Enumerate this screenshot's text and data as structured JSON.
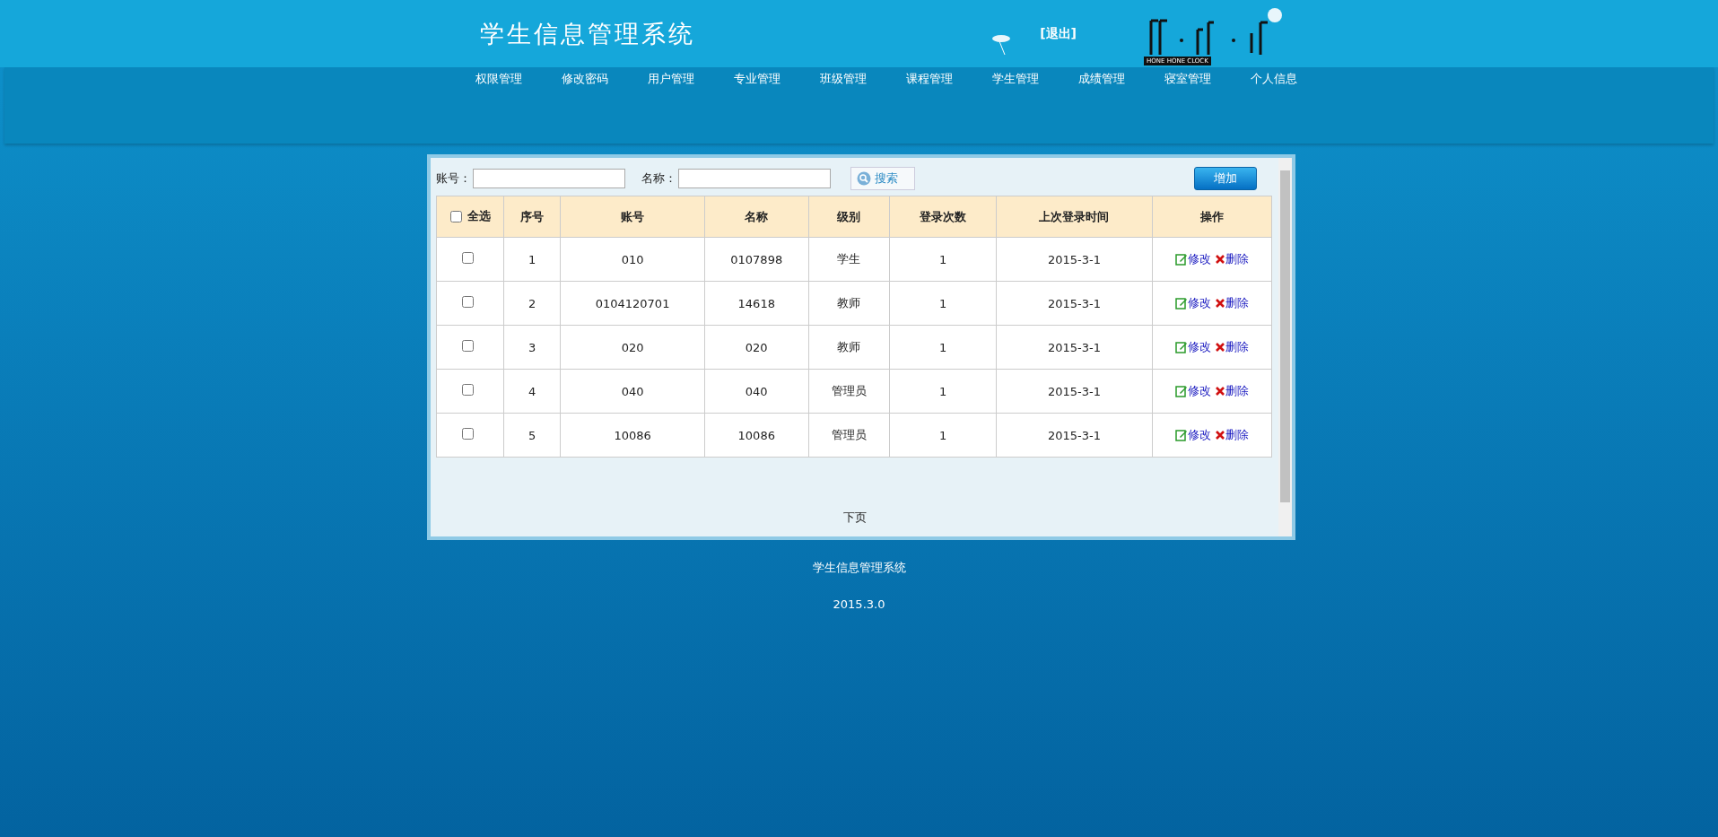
{
  "header": {
    "title": "学生信息管理系统",
    "logout": "[退出]",
    "clock_label": "HONE HONE CLOCK"
  },
  "nav": [
    "权限管理",
    "修改密码",
    "用户管理",
    "专业管理",
    "班级管理",
    "课程管理",
    "学生管理",
    "成绩管理",
    "寝室管理",
    "个人信息"
  ],
  "search": {
    "fields": [
      {
        "label": "账号："
      },
      {
        "label": "名称："
      }
    ],
    "search_button": "搜索",
    "add_button": "增加"
  },
  "table": {
    "select_all": {
      "label": "全选",
      "checked": false
    },
    "columns": [
      "序号",
      "账号",
      "名称",
      "级别",
      "登录次数",
      "上次登录时间",
      "操作"
    ],
    "rows": [
      {
        "checked": false,
        "cells": [
          "1",
          "010",
          "0107898",
          "学生",
          "1",
          "2015-3-1"
        ],
        "actions": [
          "修改",
          "删除"
        ]
      },
      {
        "checked": false,
        "cells": [
          "2",
          "0104120701",
          "14618",
          "教师",
          "1",
          "2015-3-1"
        ],
        "actions": [
          "修改",
          "删除"
        ]
      },
      {
        "checked": false,
        "cells": [
          "3",
          "020",
          "020",
          "教师",
          "1",
          "2015-3-1"
        ],
        "actions": [
          "修改",
          "删除"
        ]
      },
      {
        "checked": false,
        "cells": [
          "4",
          "040",
          "040",
          "管理员",
          "1",
          "2015-3-1"
        ],
        "actions": [
          "修改",
          "删除"
        ]
      },
      {
        "checked": false,
        "cells": [
          "5",
          "10086",
          "10086",
          "管理员",
          "1",
          "2015-3-1"
        ],
        "actions": [
          "修改",
          "删除"
        ]
      }
    ]
  },
  "pager": {
    "next": "下页"
  },
  "footer": [
    "学生信息管理系统",
    "2015.3.0"
  ]
}
